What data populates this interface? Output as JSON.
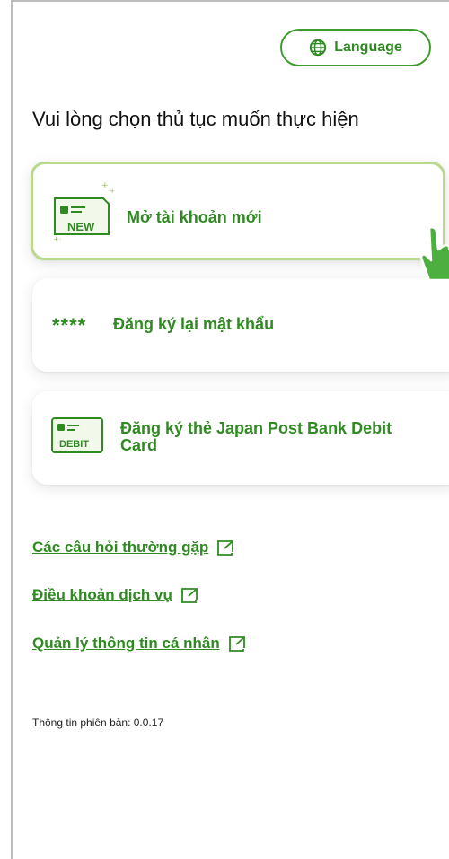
{
  "header": {
    "language_label": "Language"
  },
  "main": {
    "title": "Vui lòng chọn thủ tục muốn thực hiện",
    "options": [
      {
        "label": "Mở tài khoản mới",
        "icon_text": "NEW",
        "icon": "new-card-icon"
      },
      {
        "label": "Đăng ký lại mật khẩu",
        "icon_text": "****",
        "icon": "password-stars-icon"
      },
      {
        "label": "Đăng ký thẻ Japan Post Bank Debit Card",
        "icon_text": "DEBIT",
        "icon": "debit-card-icon"
      }
    ]
  },
  "links": [
    {
      "label": "Các câu hỏi thường gặp",
      "icon": "external-link-icon"
    },
    {
      "label": "Điều khoản dịch vụ",
      "icon": "external-link-icon"
    },
    {
      "label": "Quản lý thông tin cá nhân",
      "icon": "external-link-icon"
    }
  ],
  "footer": {
    "version_text": "Thông tin phiên bản: 0.0.17"
  },
  "colors": {
    "accent_green": "#2f8a22",
    "card_highlight_border": "#b9d98c",
    "hand_pointer": "#4caf3f"
  }
}
